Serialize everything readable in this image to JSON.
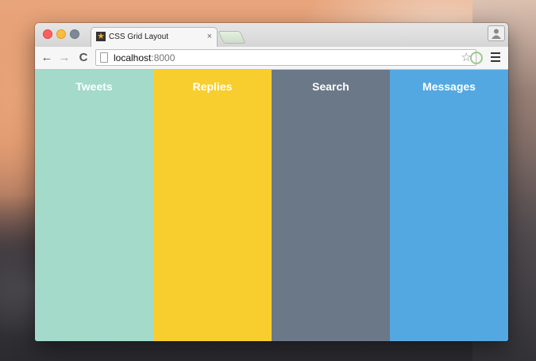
{
  "browser": {
    "tab": {
      "title": "CSS Grid Layout",
      "close_label": "×",
      "favicon": "★"
    },
    "toolbar": {
      "back_label": "←",
      "forward_label": "→",
      "reload_label": "C",
      "url_host": "localhost",
      "url_port": ":8000",
      "star_label": "☆"
    }
  },
  "grid": {
    "columns": [
      {
        "label": "Tweets",
        "color": "#a3dac9"
      },
      {
        "label": "Replies",
        "color": "#f8ce2f"
      },
      {
        "label": "Search",
        "color": "#6b7888"
      },
      {
        "label": "Messages",
        "color": "#53a8e2"
      }
    ]
  }
}
